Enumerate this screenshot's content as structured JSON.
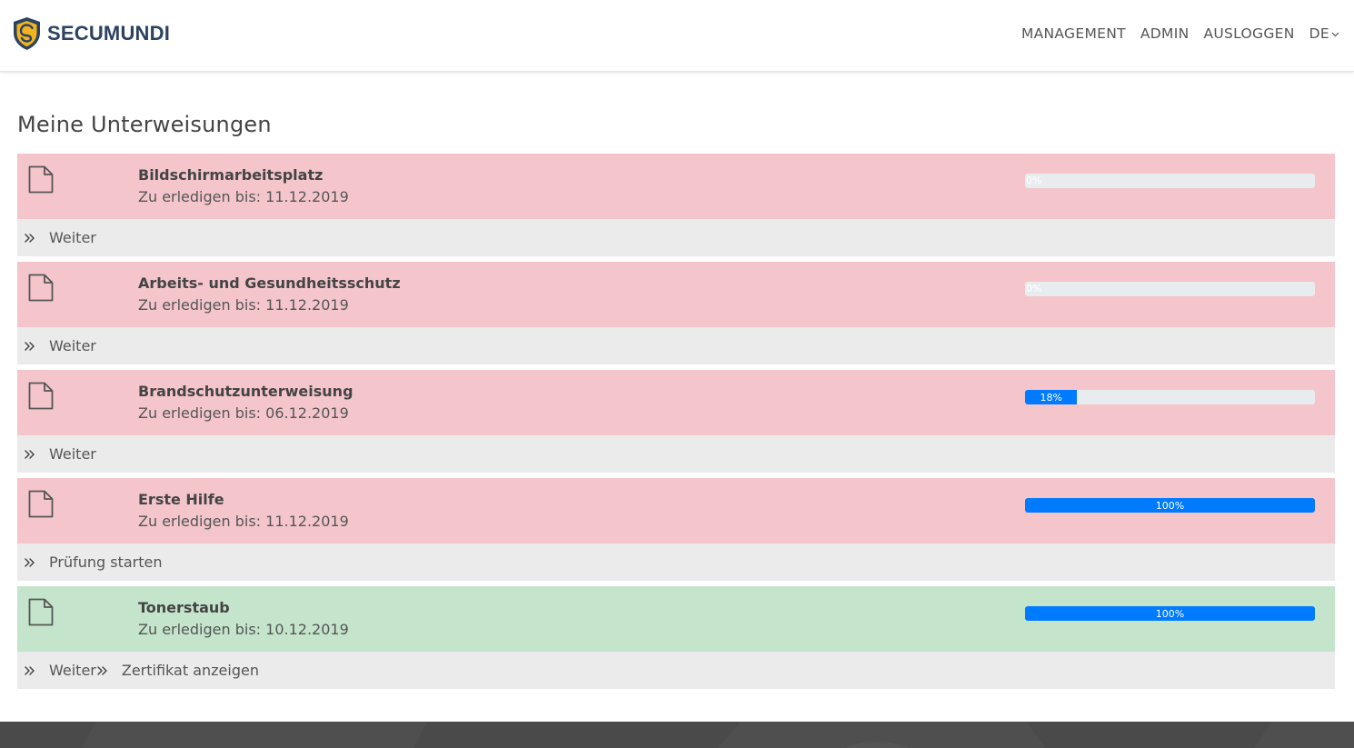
{
  "header": {
    "brand": "SECUMUNDI",
    "nav": {
      "management": "MANAGEMENT",
      "admin": "ADMIN",
      "logout": "AUSLOGGEN",
      "language": "DE"
    }
  },
  "colors": {
    "brand_dark": "#2b4262",
    "brand_gold": "#f2b41e",
    "overdue_bg": "#f4c6cc",
    "done_bg": "#c4e5cb",
    "progress_fill": "#007bff"
  },
  "main": {
    "title": "Meine Unterweisungen",
    "items": [
      {
        "title": "Bildschirmarbeitsplatz",
        "due": "Zu erledigen bis: 11.12.2019",
        "progress": 0,
        "progress_label": "0%",
        "status": "overdue",
        "actions": [
          "Weiter"
        ]
      },
      {
        "title": "Arbeits- und Gesundheitsschutz",
        "due": "Zu erledigen bis: 11.12.2019",
        "progress": 0,
        "progress_label": "0%",
        "status": "overdue",
        "actions": [
          "Weiter"
        ]
      },
      {
        "title": "Brandschutzunterweisung",
        "due": "Zu erledigen bis: 06.12.2019",
        "progress": 18,
        "progress_label": "18%",
        "status": "overdue",
        "actions": [
          "Weiter"
        ]
      },
      {
        "title": "Erste Hilfe",
        "due": "Zu erledigen bis: 11.12.2019",
        "progress": 100,
        "progress_label": "100%",
        "status": "overdue",
        "actions": [
          "Prüfung starten"
        ]
      },
      {
        "title": "Tonerstaub",
        "due": "Zu erledigen bis: 10.12.2019",
        "progress": 100,
        "progress_label": "100%",
        "status": "done",
        "actions": [
          "Weiter",
          "Zertifikat anzeigen"
        ]
      }
    ]
  }
}
